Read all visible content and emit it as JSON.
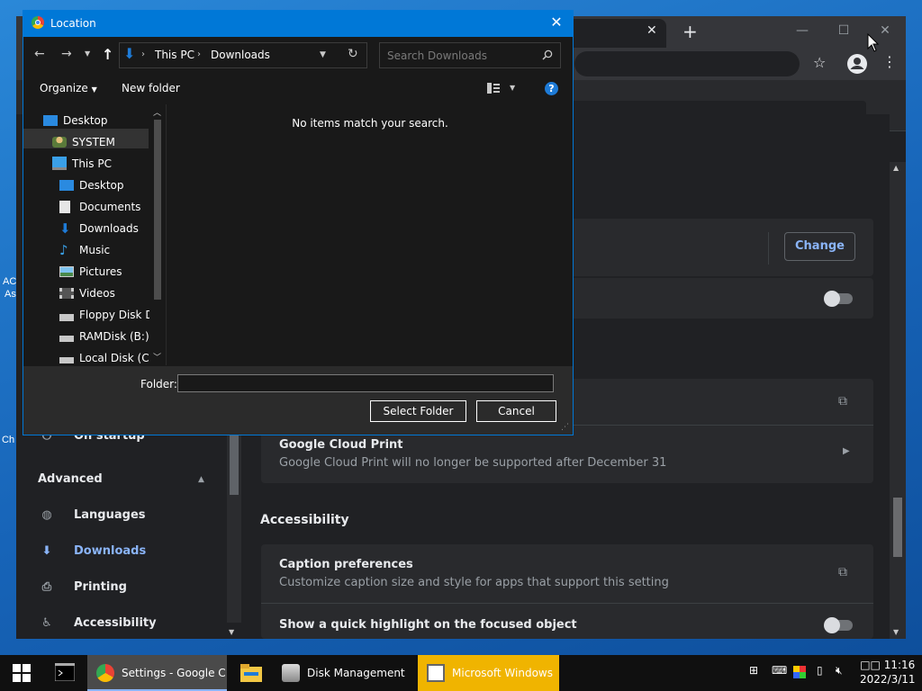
{
  "desktop": {
    "left_text_1": "AC",
    "left_text_2": "As",
    "left_text_3": "Ch"
  },
  "chrome": {
    "tab_close": "✕",
    "new_tab": "+",
    "sidebar": {
      "on_startup": "On startup",
      "advanced": "Advanced",
      "languages": "Languages",
      "downloads": "Downloads",
      "printing": "Printing",
      "accessibility": "Accessibility"
    },
    "main": {
      "change_button": "Change",
      "cloud_print_title": "Google Cloud Print",
      "cloud_print_sub": "Google Cloud Print will no longer be supported after December 31",
      "accessibility_heading": "Accessibility",
      "caption_title": "Caption preferences",
      "caption_sub": "Customize caption size and style for apps that support this setting",
      "highlight_title": "Show a quick highlight on the focused object"
    }
  },
  "dialog": {
    "title": "Location",
    "close": "✕",
    "breadcrumb": [
      "This PC",
      "Downloads"
    ],
    "search_placeholder": "Search Downloads",
    "organize": "Organize",
    "new_folder": "New folder",
    "help": "?",
    "tree": [
      {
        "label": "Desktop",
        "icon": "desktop-icon"
      },
      {
        "label": "SYSTEM",
        "icon": "user-icon"
      },
      {
        "label": "This PC",
        "icon": "computer-icon"
      },
      {
        "label": "Desktop",
        "icon": "desktop-icon"
      },
      {
        "label": "Documents",
        "icon": "documents-icon"
      },
      {
        "label": "Downloads",
        "icon": "download-icon"
      },
      {
        "label": "Music",
        "icon": "music-icon"
      },
      {
        "label": "Pictures",
        "icon": "pictures-icon"
      },
      {
        "label": "Videos",
        "icon": "videos-icon"
      },
      {
        "label": "Floppy Disk Dri",
        "icon": "floppy-icon"
      },
      {
        "label": "RAMDisk (B:)",
        "icon": "drive-icon"
      },
      {
        "label": "Local Disk (C:)",
        "icon": "drive-icon"
      }
    ],
    "empty_message": "No items match your search.",
    "folder_label": "Folder:",
    "folder_value": "",
    "select_button": "Select Folder",
    "cancel_button": "Cancel"
  },
  "taskbar": {
    "items": [
      {
        "label": "Settings - Google C...",
        "icon": "chrome-icon"
      },
      {
        "label": "Disk Management",
        "icon": "disk-management-icon"
      },
      {
        "label": "Microsoft Windows",
        "icon": "window-icon"
      }
    ],
    "time": "11:16",
    "time_prefix": "□□",
    "date": "2022/3/11"
  },
  "colors": {
    "accent": "#0078d7",
    "link": "#8ab4f8",
    "highlight_task": "#f0b400"
  }
}
